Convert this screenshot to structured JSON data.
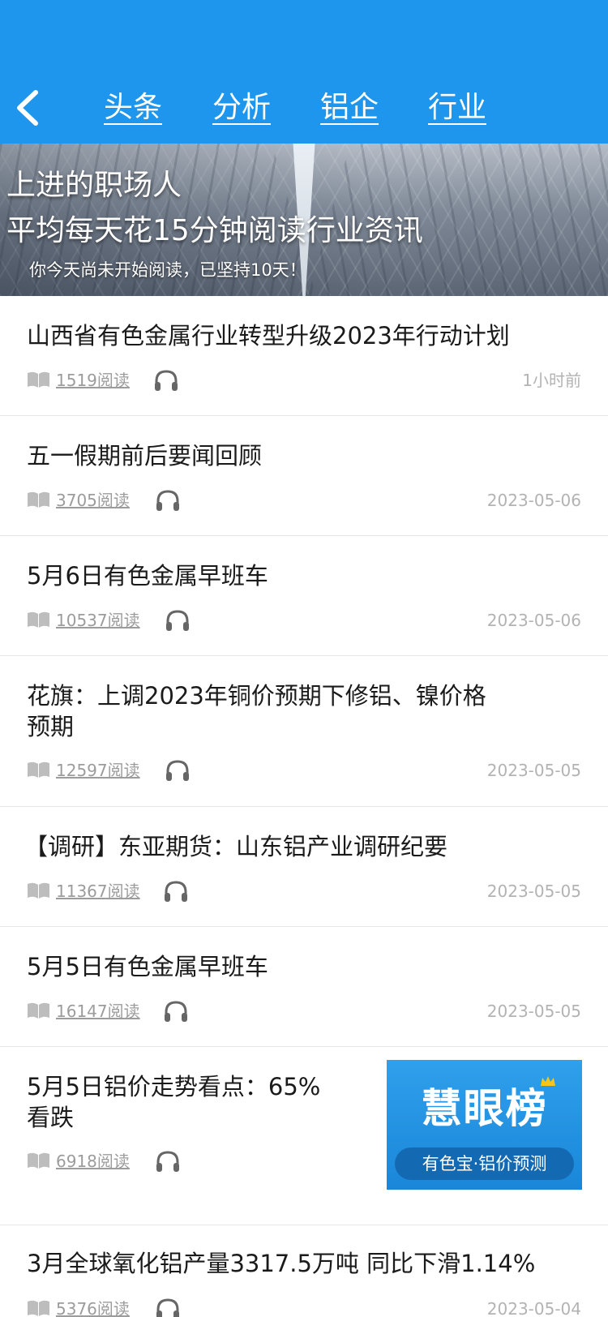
{
  "header": {
    "back_icon": "chevron-left-icon",
    "tabs": [
      {
        "label": "头条",
        "active": true
      },
      {
        "label": "分析"
      },
      {
        "label": "铝企"
      },
      {
        "label": "行业"
      }
    ],
    "color": "#1e96ee"
  },
  "banner": {
    "line1": "上进的职场人",
    "line2": "平均每天花15分钟阅读行业资讯",
    "subtitle": "你今天尚未开始阅读，已坚持10天！"
  },
  "articles": [
    {
      "title": "山西省有色金属行业转型升级2023年行动计划",
      "reads": "1519阅读",
      "time": "1小时前"
    },
    {
      "title": "五一假期前后要闻回顾",
      "reads": "3705阅读",
      "time": "2023-05-06"
    },
    {
      "title": "5月6日有色金属早班车",
      "reads": "10537阅读",
      "time": "2023-05-06"
    },
    {
      "title_line1": "花旗：上调2023年铜价预期下修铝、镍价格",
      "title_line2": "预期",
      "reads": "12597阅读",
      "time": "2023-05-05"
    },
    {
      "title": "【调研】东亚期货：山东铝产业调研纪要",
      "reads": "11367阅读",
      "time": "2023-05-05"
    },
    {
      "title": "5月5日有色金属早班车",
      "reads": "16147阅读",
      "time": "2023-05-05"
    },
    {
      "title_line1": "5月5日铝价走势看点：65%",
      "title_line2": "看跌",
      "reads": "6918阅读",
      "time": "",
      "ad": {
        "title": "慧眼榜",
        "pill": "有色宝·铝价预测"
      }
    },
    {
      "title": "3月全球氧化铝产量3317.5万吨 同比下滑1.14%",
      "reads": "5376阅读",
      "time": "2023-05-04"
    }
  ],
  "icons": {
    "book": "book-icon",
    "headphone": "headphone-icon"
  }
}
